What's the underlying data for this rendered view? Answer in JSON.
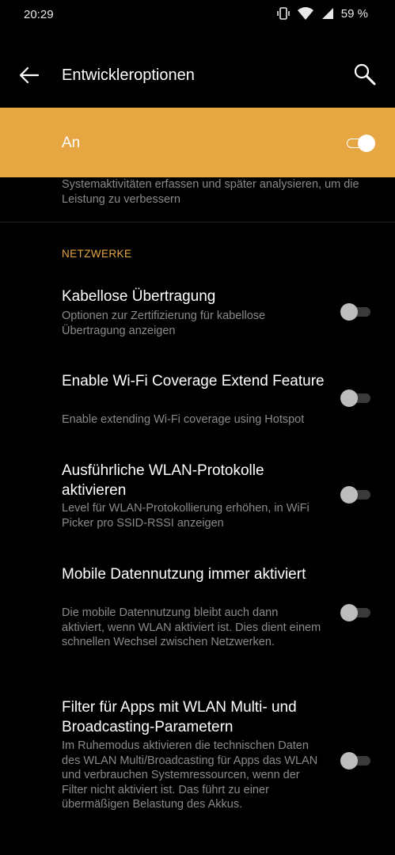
{
  "status_bar": {
    "time": "20:29",
    "battery": "59 %",
    "icons": [
      "vibrate-icon",
      "wifi-icon",
      "cellular-signal-icon"
    ]
  },
  "app_bar": {
    "title": "Entwickleroptionen",
    "icons": [
      "back-arrow-icon",
      "search-icon"
    ]
  },
  "master_switch": {
    "label": "An",
    "state": "on"
  },
  "top_note": "Systemaktivitäten erfassen und später analysieren, um die Leistung zu verbessern",
  "section": {
    "title": "NETZWERKE"
  },
  "items": [
    {
      "title": "Kabellose Übertragung",
      "summary": "Optionen zur Zertifizierung für kabellose Übertragung anzeigen",
      "state": "off"
    },
    {
      "title": "Enable Wi-Fi Coverage Extend Feature",
      "summary": "Enable extending Wi-Fi coverage using Hotspot",
      "state": "off"
    },
    {
      "title": "Ausführliche WLAN-Protokolle aktivieren",
      "summary": "Level für WLAN-Protokollierung erhöhen, in WiFi Picker pro SSID-RSSI anzeigen",
      "state": "off"
    },
    {
      "title": "Mobile Datennutzung immer aktiviert",
      "summary": "Die mobile Datennutzung bleibt auch dann aktiviert, wenn WLAN aktiviert ist. Dies dient einem schnellen Wechsel zwischen Netzwerken.",
      "state": "off"
    },
    {
      "title": "Filter für Apps mit WLAN Multi- und Broadcasting-Parametern",
      "summary": "Im Ruhemodus aktivieren die technischen Daten des WLAN Multi/Broadcasting für Apps das WLAN und verbrauchen Systemressourcen, wenn der Filter nicht aktiviert ist. Das führt zu einer übermäßigen Belastung des Akkus.",
      "state": "off"
    }
  ],
  "colors": {
    "accent": "#e6a743",
    "background": "#000000",
    "secondary_text": "#8a8a8a"
  }
}
